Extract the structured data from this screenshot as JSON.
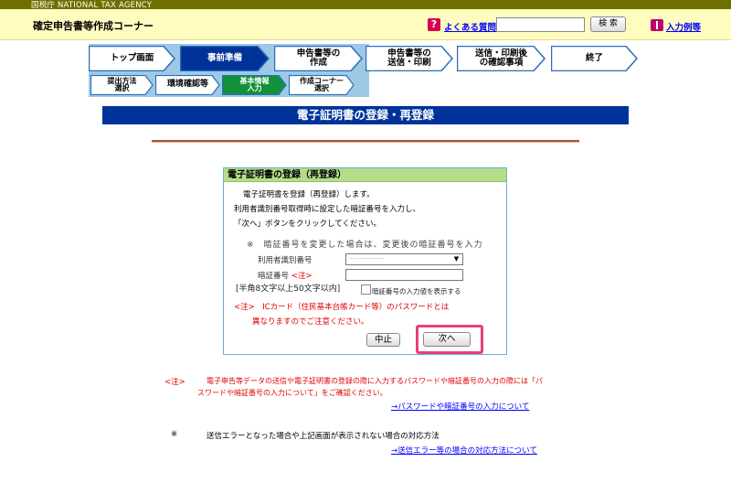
{
  "agency_bar": {
    "text": "国税庁 NATIONAL TAX AGENCY"
  },
  "header": {
    "title": "確定申告書等作成コーナー",
    "faq_icon": "?",
    "faq_link": "よくある質問",
    "search_button": "検 索",
    "example_link": "入力例等"
  },
  "steps": [
    {
      "label": "トップ画面",
      "state": "done"
    },
    {
      "label": "事前準備",
      "state": "current"
    },
    {
      "label": "申告書等の\n作成",
      "state": "todo"
    },
    {
      "label": "申告書等の\n送信・印刷",
      "state": "todo"
    },
    {
      "label": "送信・印刷後\nの確認事項",
      "state": "todo"
    },
    {
      "label": "終了",
      "state": "todo"
    }
  ],
  "substeps": [
    {
      "label": "提出方法\n選択",
      "state": "done"
    },
    {
      "label": "環境確認等",
      "state": "done"
    },
    {
      "label": "基本情報\n入力",
      "state": "current"
    },
    {
      "label": "作成コーナー\n選択",
      "state": "todo"
    }
  ],
  "banner": "電子証明書の登録・再登録",
  "panel": {
    "title": "電子証明書の登録（再登録）",
    "line1": "電子証明書を登録（再登録）します。",
    "line2": "利用者識別番号取得時に設定した暗証番号を入力し、",
    "line3": "「次へ」ボタンをクリックしてください。",
    "note": "※　暗証番号を変更した場合は、変更後の暗証番号を入力",
    "userid_label": "利用者識別番号",
    "userid_value": "··············",
    "pin_label": "暗証番号",
    "pin_required": "<注>",
    "pin_hint": "[半角8文字以上50文字以内]",
    "show_pin_label": "暗証番号の入力値を表示する",
    "warn1": "<注>　ICカード（住民基本台帳カード等）のパスワードとは",
    "warn2": "異なりますのでご注意ください。",
    "cancel_button": "中止",
    "next_button": "次へ"
  },
  "footer": {
    "note_mark": "<注>",
    "note_line1": "電子申告等データの送信や電子証明書の登録の際に入力するパスワードや暗証番号の入力の際には「パ",
    "note_line2": "スワードや暗証番号の入力について」をご確認ください。",
    "note_link": "→パスワードや暗証番号の入力について",
    "error_mark": "※",
    "error_text": "送信エラーとなった場合や上記画面が表示されない場合の対応方法",
    "error_link": "→送信エラー等の場合の対応方法について"
  },
  "colors": {
    "step_done": "#ffffff",
    "step_current": "#003399",
    "sub_current": "#12903a",
    "step_border": "#2d6db6",
    "banner": "#003399",
    "highlight": "#e8407a"
  }
}
